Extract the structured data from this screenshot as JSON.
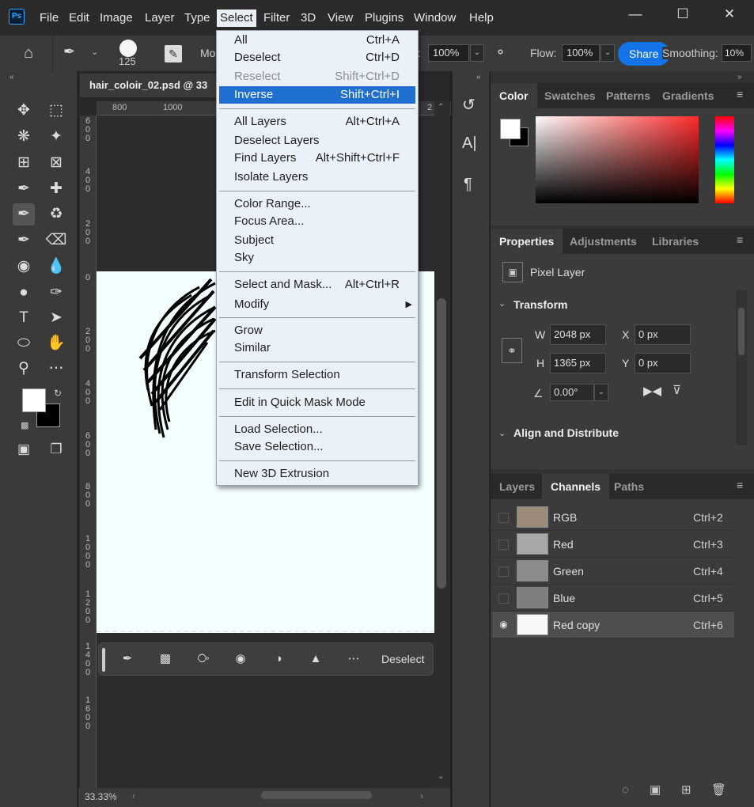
{
  "menubar": {
    "items": [
      "File",
      "Edit",
      "Image",
      "Layer",
      "Type",
      "Select",
      "Filter",
      "3D",
      "View",
      "Plugins",
      "Window",
      "Help"
    ],
    "active": "Select"
  },
  "options": {
    "brush_size": "125",
    "mode_label": "Mo",
    "opacity_value": "100%",
    "flow_label": "Flow:",
    "flow_value": "100%",
    "share_label": "Share",
    "smoothing_label": "Smoothing:",
    "smoothing_value": "10%"
  },
  "document": {
    "tab_title": "hair_coloir_02.psd @ 33",
    "ruler_marks": [
      "800",
      "1000"
    ],
    "ruler_right": "2",
    "vruler": [
      "6\n0\n0",
      "4\n0\n0",
      "2\n0\n0",
      "0",
      "2\n0\n0",
      "4\n0\n0",
      "6\n0\n0",
      "8\n0\n0",
      "1\n0\n0\n0",
      "1\n2\n0\n0",
      "1\n4\n0\n0",
      "1\n6\n0\n0"
    ],
    "zoom": "33.33%"
  },
  "taskbar": {
    "deselect_label": "Deselect"
  },
  "select_menu": {
    "groups": [
      [
        {
          "label": "All",
          "shortcut": "Ctrl+A"
        },
        {
          "label": "Deselect",
          "shortcut": "Ctrl+D"
        },
        {
          "label": "Reselect",
          "shortcut": "Shift+Ctrl+D",
          "disabled": true
        },
        {
          "label": "Inverse",
          "shortcut": "Shift+Ctrl+I",
          "highlighted": true
        }
      ],
      [
        {
          "label": "All Layers",
          "shortcut": "Alt+Ctrl+A"
        },
        {
          "label": "Deselect Layers",
          "shortcut": ""
        },
        {
          "label": "Find Layers",
          "shortcut": "Alt+Shift+Ctrl+F"
        },
        {
          "label": "Isolate Layers",
          "shortcut": ""
        }
      ],
      [
        {
          "label": "Color Range...",
          "shortcut": ""
        },
        {
          "label": "Focus Area...",
          "shortcut": ""
        },
        {
          "label": "Subject",
          "shortcut": ""
        },
        {
          "label": "Sky",
          "shortcut": ""
        }
      ],
      [
        {
          "label": "Select and Mask...",
          "shortcut": "Alt+Ctrl+R"
        },
        {
          "label": "Modify",
          "shortcut": "",
          "submenu": true
        }
      ],
      [
        {
          "label": "Grow",
          "shortcut": ""
        },
        {
          "label": "Similar",
          "shortcut": ""
        }
      ],
      [
        {
          "label": "Transform Selection",
          "shortcut": ""
        }
      ],
      [
        {
          "label": "Edit in Quick Mask Mode",
          "shortcut": ""
        }
      ],
      [
        {
          "label": "Load Selection...",
          "shortcut": ""
        },
        {
          "label": "Save Selection...",
          "shortcut": ""
        }
      ],
      [
        {
          "label": "New 3D Extrusion",
          "shortcut": ""
        }
      ]
    ]
  },
  "color_panel": {
    "tabs": [
      "Color",
      "Swatches",
      "Patterns",
      "Gradients"
    ],
    "active": "Color",
    "hue_color": "#ff2a2a"
  },
  "properties_panel": {
    "tabs": [
      "Properties",
      "Adjustments",
      "Libraries"
    ],
    "active": "Properties",
    "layer_type": "Pixel Layer",
    "transform_title": "Transform",
    "w_label": "W",
    "w_value": "2048 px",
    "h_label": "H",
    "h_value": "1365 px",
    "x_label": "X",
    "x_value": "0 px",
    "y_label": "Y",
    "y_value": "0 px",
    "angle_value": "0.00°",
    "align_title": "Align and Distribute"
  },
  "channels_panel": {
    "tabs": [
      "Layers",
      "Channels",
      "Paths"
    ],
    "active": "Channels",
    "rows": [
      {
        "name": "RGB",
        "shortcut": "Ctrl+2"
      },
      {
        "name": "Red",
        "shortcut": "Ctrl+3"
      },
      {
        "name": "Green",
        "shortcut": "Ctrl+4"
      },
      {
        "name": "Blue",
        "shortcut": "Ctrl+5"
      },
      {
        "name": "Red copy",
        "shortcut": "Ctrl+6"
      }
    ]
  }
}
